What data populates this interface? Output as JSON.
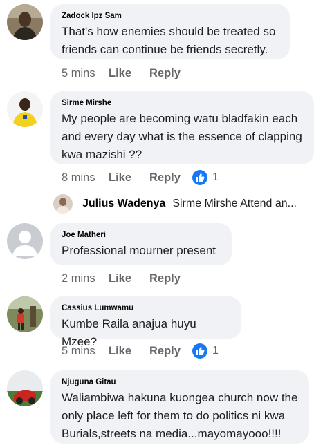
{
  "comments": [
    {
      "author": "Zadock Ipz Sam",
      "text_lines": [
        "That's how enemies should be treated so",
        "friends can continue be friends secretly."
      ],
      "time": "5 mins",
      "like": "Like",
      "reply": "Reply",
      "reactions": null
    },
    {
      "author": "Sirme Mirshe",
      "text_lines": [
        "My people are becoming watu bladfakin each",
        "and every day what is the essence of clapping",
        "kwa mazishi ??"
      ],
      "time": "8 mins",
      "like": "Like",
      "reply": "Reply",
      "reactions": "1"
    },
    {
      "author": "Joe Matheri",
      "text_lines": [
        "Professional mourner present"
      ],
      "time": "2 mins",
      "like": "Like",
      "reply": "Reply",
      "reactions": null
    },
    {
      "author": "Cassius Lumwamu",
      "text_lines": [
        "Kumbe Raila anajua huyu Mzee?"
      ],
      "time": "5 mins",
      "like": "Like",
      "reply": "Reply",
      "reactions": "1"
    },
    {
      "author": "Njuguna Gitau",
      "text_lines": [
        "Waliambiwa hakuna kuongea church now the",
        "only place left for them to do politics ni kwa",
        "Burials,streets na media...mayomayooo!!!!"
      ],
      "time": "",
      "like": "",
      "reply": "",
      "reactions": null
    }
  ],
  "nested_reply": {
    "author": "Julius Wadenya",
    "preview": "Sirme Mirshe Attend an..."
  },
  "icons": {
    "reaction": "thumbs-up-icon",
    "placeholder_avatar": "default-avatar-icon"
  },
  "colors": {
    "bubble": "#f0f2f5",
    "secondary_text": "#65676b",
    "like_blue": "#1877f2"
  }
}
